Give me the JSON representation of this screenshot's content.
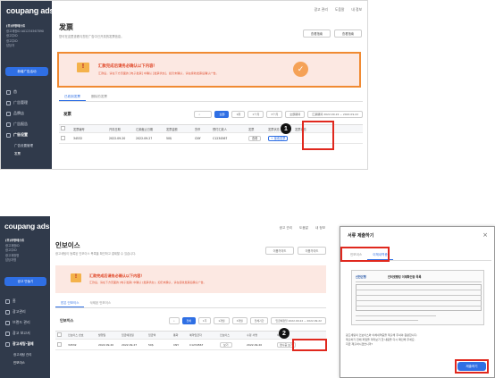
{
  "brand": "coupang ads",
  "shot1": {
    "sidebar": {
      "account_lines": [
        "(주)쿠팡테스트",
        "광고계정ID A01234567890",
        "광고주ID",
        "광고주ID",
        "담당자"
      ],
      "create_button": "新增广告活动",
      "nav": [
        "首",
        "广告管理",
        "品牌店",
        "广告报告",
        "广告设置"
      ],
      "submenu": [
        "广告设置管理",
        "发票"
      ]
    },
    "topbar": [
      "광고 관리",
      "도움말",
      "내 정보"
    ],
    "page_title": "发票",
    "page_desc": "您可在这里查看与您在广告中已开具的发票信息。",
    "top_buttons": [
      "查看指南",
      "查看指南"
    ],
    "alert": {
      "title": "汇款完成后请务必确认以下内容！",
      "body": "汇款后，请在下方页面的 [电子发票] 中确认 [发票状态]，如仍未确认，请在接收发票后确认广告。"
    },
    "tabs": [
      "已收到发票",
      "删除的发票"
    ],
    "section_title": "发票",
    "filters": [
      "全部",
      "1周",
      "1个月",
      "3个月",
      "全部期间"
    ],
    "date_label": "汇票期间",
    "date_range": "2022.09.22 ~ 2022.09.22",
    "table": {
      "headers": [
        "发票编号",
        "开具日期",
        "汇款截止日期",
        "发票金额",
        "货币",
        "预付汇款人",
        "发票",
        "发票状态",
        "发票状态"
      ],
      "row": [
        "34532",
        "2022.09.20",
        "2022.09.27",
        "50$",
        "CNY",
        "C1234567",
        "查看",
        "+ 接收发票",
        ""
      ]
    },
    "badge": "1"
  },
  "shot2": {
    "sidebar": {
      "account_lines": [
        "(주)쿠팡테스트",
        "광고계정ID",
        "광고주ID",
        "광고계정명",
        "담당자명"
      ],
      "create_button": "광고 만들기",
      "nav": [
        "홈",
        "광고관리",
        "브랜드 관리",
        "광고 보고서",
        "광고세팅·결제"
      ],
      "submenu": [
        "광고세팅 관리",
        "인보이스"
      ]
    },
    "topbar": [
      "광고 관리",
      "도움말",
      "내 정보"
    ],
    "page_title": "인보이스",
    "page_desc": "광고세팅이 등록된 인보이스 목록을 확인하고 결제할 수 있습니다.",
    "top_buttons": [
      "이용가이드",
      "이용가이드"
    ],
    "alert": {
      "title": "汇款完成后请务必确认以下内容！",
      "body": "汇款后，请在下方页面的 [电子发票] 中确认 [发票状态]，如仍未确认，请在接收发票后确认广告。"
    },
    "tabs": [
      "받은 인보이스",
      "삭제된 인보이스"
    ],
    "section_title": "인보이스",
    "filters": [
      "전체",
      "1주",
      "1개월",
      "3개월",
      "전체기간"
    ],
    "date_label": "입금예정일",
    "date_range": "2022.09.22 ~ 2022.09.22",
    "table": {
      "headers": [
        "인보이스 번호",
        "발행일",
        "입금예정일",
        "입금액",
        "통화",
        "예약입금자",
        "인보이스",
        "수령 서명",
        "세금계산서"
      ],
      "row": [
        "34532",
        "2022.09.20",
        "2022.09.27",
        "50$",
        "CNY",
        "C1234567",
        "보기",
        "2022.09.20",
        "영수증 보기"
      ]
    },
    "badge": "2"
  },
  "dialog": {
    "title": "서류 제출하기",
    "tabs": [
      "인보이스",
      "이체내역증"
    ],
    "doc_bank": "신한은행",
    "doc_title": "인터넷뱅킹 이체확인증 목록",
    "note_lines": [
      "광고세팅의 인보이스와 이체내역증을 제출해 주셔야 원활합니다.",
      "제출하기 전에 파일을 미리보기 한 내용을 다시 확인해 주세요.",
      "지금 제출하시겠습니까?"
    ],
    "submit": "제출하기"
  },
  "colors": {
    "sidebar": "#303a4b",
    "accent": "#2f6fe4",
    "highlight": "#e0281e",
    "alert_border": "#f08a32"
  }
}
